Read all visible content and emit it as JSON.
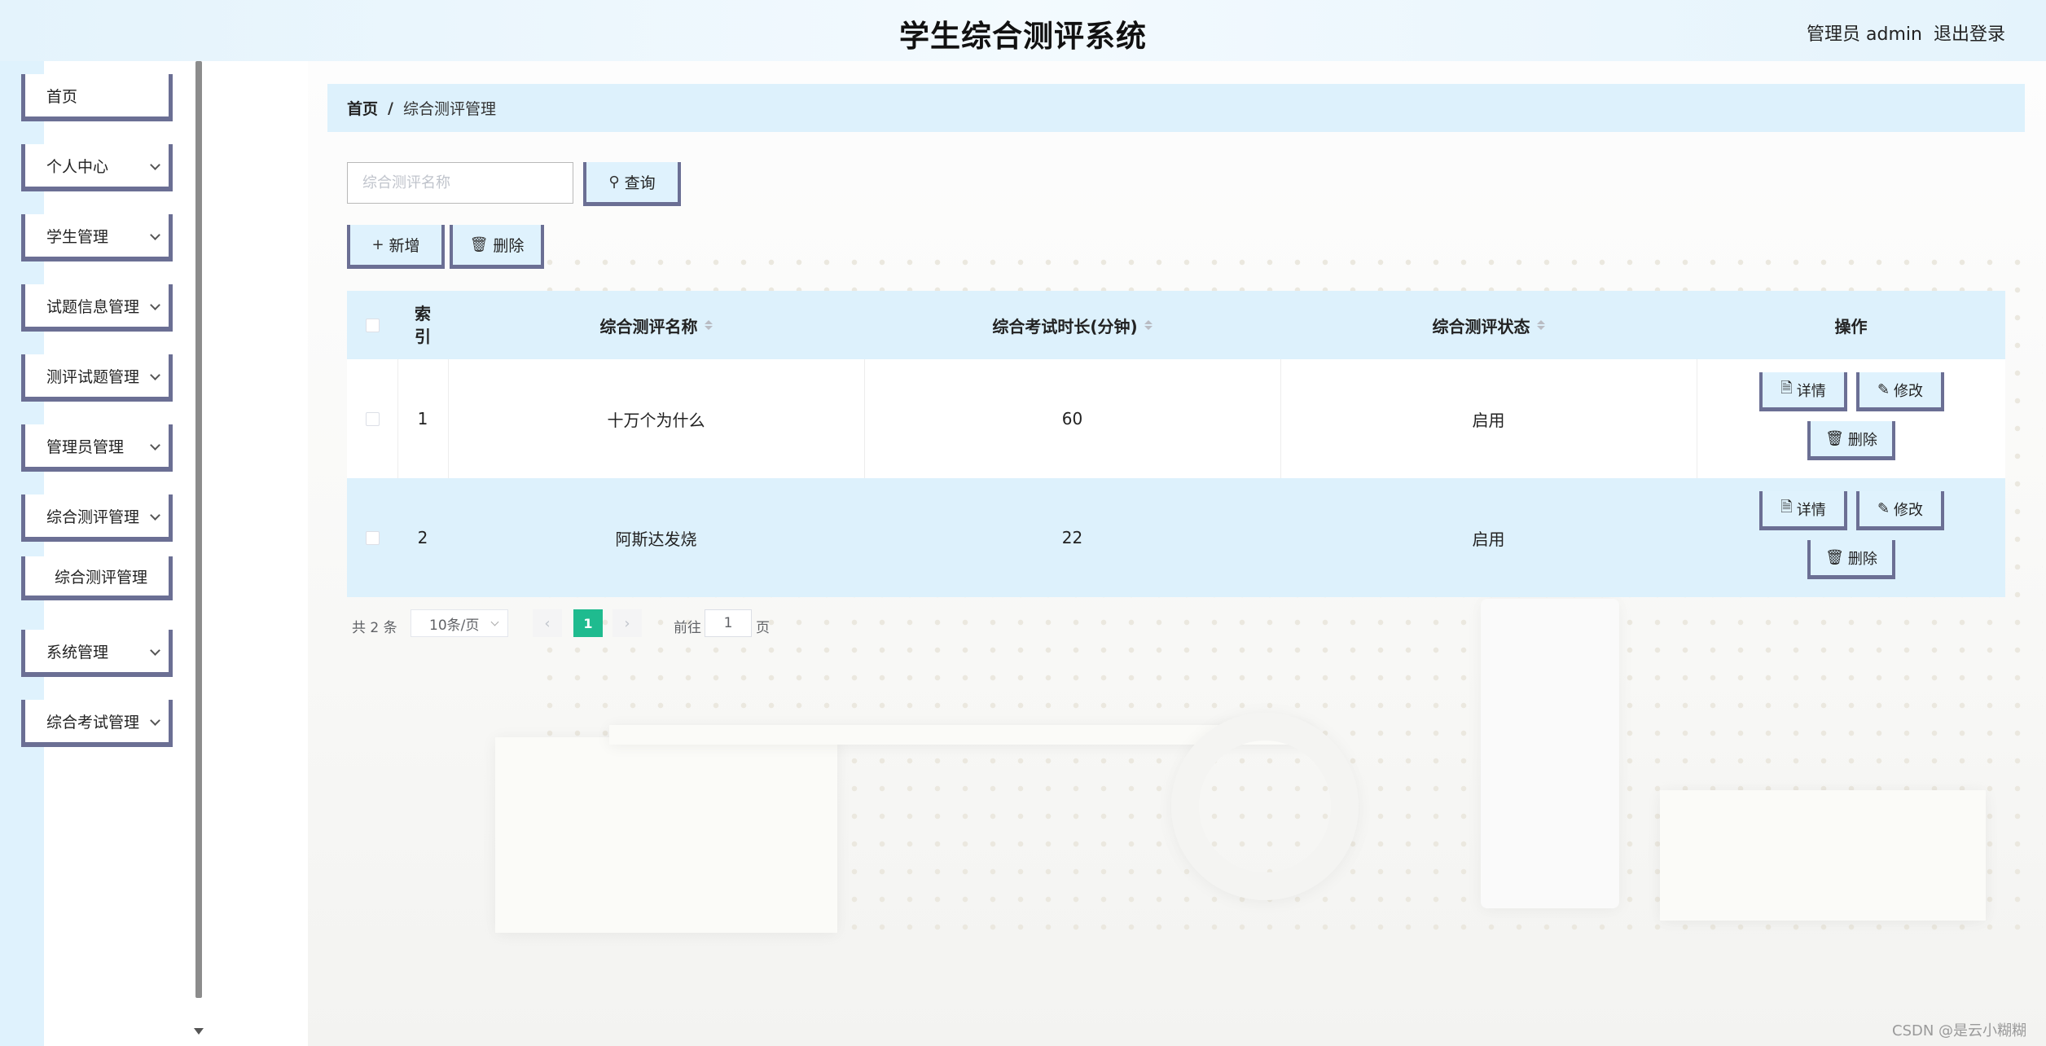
{
  "header": {
    "title": "学生综合测评系统",
    "user": "管理员 admin",
    "logout": "退出登录"
  },
  "sidebar": {
    "items": [
      {
        "label": "首页"
      },
      {
        "label": "个人中心"
      },
      {
        "label": "学生管理"
      },
      {
        "label": "试题信息管理"
      },
      {
        "label": "测评试题管理"
      },
      {
        "label": "管理员管理"
      },
      {
        "label": "综合测评管理"
      },
      {
        "label": "综合测评管理"
      },
      {
        "label": "系统管理"
      },
      {
        "label": "综合考试管理"
      }
    ]
  },
  "breadcrumb": {
    "home": "首页",
    "separator": "/",
    "current": "综合测评管理"
  },
  "search": {
    "placeholder": "综合测评名称",
    "button": "查询"
  },
  "toolbar": {
    "add": "新增",
    "delete": "删除"
  },
  "table": {
    "columns": [
      "索引",
      "综合测评名称",
      "综合考试时长(分钟)",
      "综合测评状态",
      "操作"
    ],
    "rows": [
      {
        "index": "1",
        "name": "十万个为什么",
        "duration": "60",
        "status": "启用"
      },
      {
        "index": "2",
        "name": "阿斯达发烧",
        "duration": "22",
        "status": "启用"
      }
    ],
    "actions": {
      "detail": "详情",
      "edit": "修改",
      "delete": "删除"
    }
  },
  "pagination": {
    "total": "共 2 条",
    "page_size": "10条/页",
    "current_page": "1",
    "goto_label": "前往",
    "goto_value": "1",
    "page_suffix": "页"
  },
  "watermark": "CSDN @是云小糊糊",
  "colors": {
    "accent": "#1fbb8f",
    "header_bg": "#e4f3fc",
    "breadcrumb_bg": "#ddf1fc",
    "button_border": "#6b6f94"
  }
}
